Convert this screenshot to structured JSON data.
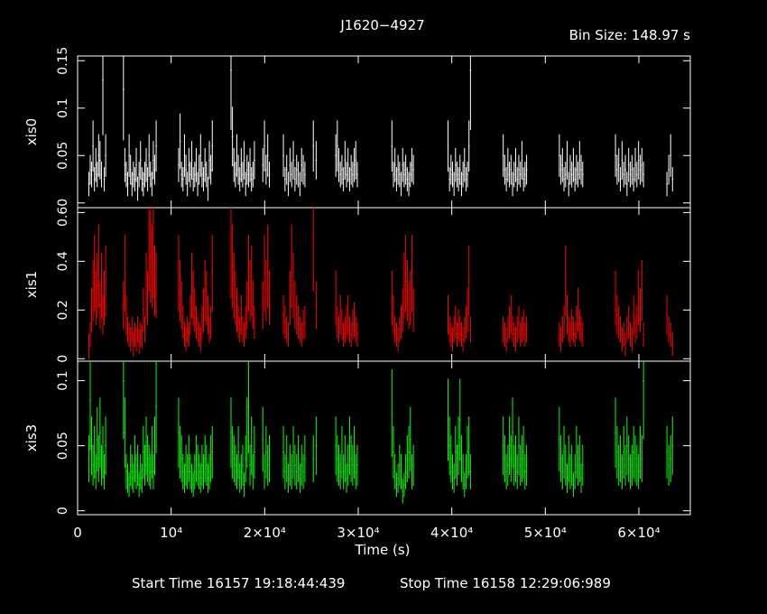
{
  "title": "J1620−4927",
  "bin_size_label": "Bin Size: 148.97 s",
  "footer": {
    "start": "Start Time 16157 19:18:44:439",
    "stop": "Stop Time 16158 12:29:06:989"
  },
  "colors": {
    "background": "#000000",
    "axes": "#ffffff",
    "xis0": "#ffffff",
    "xis1": "#ff0000",
    "xis3": "#00ff00"
  },
  "chart_data": {
    "type": "scatter",
    "title": "J1620−4927",
    "xlabel": "Time (s)",
    "xlim": [
      0,
      65500
    ],
    "x_ticks": [
      {
        "value": 0,
        "label": "0"
      },
      {
        "value": 10000,
        "label": "10⁴"
      },
      {
        "value": 20000,
        "label": "2×10⁴"
      },
      {
        "value": 30000,
        "label": "3×10⁴"
      },
      {
        "value": 40000,
        "label": "4×10⁴"
      },
      {
        "value": 50000,
        "label": "5×10⁴"
      },
      {
        "value": 60000,
        "label": "6×10⁴"
      }
    ],
    "panels": [
      {
        "name": "xis0",
        "ylabel": "xis0",
        "color": "#ffffff",
        "ylim": [
          -0.005,
          0.155
        ],
        "yticks": [
          {
            "value": 0,
            "label": ""
          },
          {
            "value": 0.05,
            "label": "0.05"
          },
          {
            "value": 0.1,
            "label": "0.1"
          },
          {
            "value": 0.15,
            "label": "0.15"
          }
        ],
        "segments": [
          {
            "t_start": 1200,
            "t_end": 3000,
            "values": [
              0.02,
              0.035,
              0.03,
              0.06,
              0.025,
              0.04,
              0.03,
              0.05,
              0.045,
              0.03,
              0.13,
              0.025,
              0.05
            ]
          },
          {
            "t_start": 4900,
            "t_end": 8400,
            "values": [
              0.12,
              0.04,
              0.03,
              0.02,
              0.05,
              0.035,
              0.02,
              0.03,
              0.025,
              0.04,
              0.015,
              0.03,
              0.045,
              0.025,
              0.02,
              0.03,
              0.04,
              0.025,
              0.05,
              0.03,
              0.02,
              0.045,
              0.035,
              0.06
            ]
          },
          {
            "t_start": 10800,
            "t_end": 14400,
            "values": [
              0.04,
              0.065,
              0.03,
              0.025,
              0.05,
              0.035,
              0.02,
              0.04,
              0.03,
              0.045,
              0.025,
              0.03,
              0.04,
              0.02,
              0.035,
              0.05,
              0.03,
              0.025,
              0.04,
              0.03,
              0.015,
              0.045,
              0.035,
              0.06
            ]
          },
          {
            "t_start": 16400,
            "t_end": 18900,
            "values": [
              0.14,
              0.07,
              0.04,
              0.03,
              0.05,
              0.035,
              0.025,
              0.04,
              0.03,
              0.045,
              0.02,
              0.035,
              0.03,
              0.04,
              0.025,
              0.03,
              0.045
            ]
          },
          {
            "t_start": 19800,
            "t_end": 20500,
            "values": [
              0.04,
              0.06,
              0.035,
              0.05,
              0.03
            ]
          },
          {
            "t_start": 22000,
            "t_end": 24300,
            "values": [
              0.05,
              0.025,
              0.035,
              0.02,
              0.04,
              0.03,
              0.045,
              0.025,
              0.035,
              0.03,
              0.02,
              0.04,
              0.035,
              0.03
            ]
          },
          {
            "t_start": 25200,
            "t_end": 25500,
            "values": [
              0.06,
              0.045
            ]
          },
          {
            "t_start": 27600,
            "t_end": 29900,
            "values": [
              0.05,
              0.06,
              0.04,
              0.03,
              0.035,
              0.025,
              0.045,
              0.03,
              0.04,
              0.025,
              0.035,
              0.03,
              0.04,
              0.045,
              0.03
            ]
          },
          {
            "t_start": 33600,
            "t_end": 35900,
            "values": [
              0.06,
              0.03,
              0.04,
              0.025,
              0.035,
              0.03,
              0.02,
              0.04,
              0.03,
              0.035,
              0.025,
              0.02,
              0.03,
              0.04,
              0.035
            ]
          },
          {
            "t_start": 39600,
            "t_end": 42000,
            "values": [
              0.06,
              0.025,
              0.035,
              0.03,
              0.02,
              0.04,
              0.03,
              0.025,
              0.035,
              0.02,
              0.03,
              0.04,
              0.025,
              0.03,
              0.06,
              0.14
            ]
          },
          {
            "t_start": 45500,
            "t_end": 48000,
            "values": [
              0.05,
              0.035,
              0.025,
              0.04,
              0.03,
              0.035,
              0.02,
              0.03,
              0.04,
              0.025,
              0.035,
              0.03,
              0.045,
              0.025,
              0.03,
              0.035
            ]
          },
          {
            "t_start": 51500,
            "t_end": 54000,
            "values": [
              0.05,
              0.035,
              0.04,
              0.025,
              0.03,
              0.045,
              0.02,
              0.035,
              0.03,
              0.04,
              0.025,
              0.035,
              0.03,
              0.045,
              0.035,
              0.03
            ]
          },
          {
            "t_start": 57500,
            "t_end": 60500,
            "values": [
              0.05,
              0.035,
              0.04,
              0.025,
              0.045,
              0.03,
              0.035,
              0.02,
              0.04,
              0.03,
              0.035,
              0.025,
              0.04,
              0.03,
              0.045,
              0.035,
              0.04,
              0.03
            ]
          },
          {
            "t_start": 63000,
            "t_end": 63600,
            "values": [
              0.02,
              0.035,
              0.05,
              0.025
            ]
          }
        ]
      },
      {
        "name": "xis1",
        "ylabel": "xis1",
        "color": "#ff0000",
        "ylim": [
          -0.01,
          0.62
        ],
        "yticks": [
          {
            "value": 0,
            "label": "0"
          },
          {
            "value": 0.2,
            "label": "0.2"
          },
          {
            "value": 0.4,
            "label": "0.4"
          },
          {
            "value": 0.6,
            "label": "0.60"
          }
        ],
        "segments": [
          {
            "t_start": 1200,
            "t_end": 3000,
            "values": [
              0.05,
              0.1,
              0.2,
              0.28,
              0.35,
              0.25,
              0.3,
              0.38,
              0.22,
              0.3,
              0.18,
              0.25,
              0.32
            ]
          },
          {
            "t_start": 4900,
            "t_end": 8400,
            "values": [
              0.22,
              0.35,
              0.18,
              0.12,
              0.1,
              0.08,
              0.12,
              0.06,
              0.1,
              0.08,
              0.12,
              0.07,
              0.1,
              0.09,
              0.2,
              0.12,
              0.3,
              0.25,
              0.5,
              0.42,
              0.38,
              0.45,
              0.32,
              0.3
            ]
          },
          {
            "t_start": 10800,
            "t_end": 14400,
            "values": [
              0.35,
              0.28,
              0.22,
              0.15,
              0.1,
              0.08,
              0.12,
              0.1,
              0.18,
              0.3,
              0.25,
              0.2,
              0.15,
              0.12,
              0.1,
              0.08,
              0.15,
              0.2,
              0.28,
              0.25,
              0.18,
              0.12,
              0.15,
              0.35
            ]
          },
          {
            "t_start": 16400,
            "t_end": 18900,
            "values": [
              0.45,
              0.38,
              0.3,
              0.25,
              0.2,
              0.15,
              0.12,
              0.18,
              0.12,
              0.1,
              0.15,
              0.22,
              0.35,
              0.28,
              0.32,
              0.22,
              0.15
            ]
          },
          {
            "t_start": 19800,
            "t_end": 20500,
            "values": [
              0.22,
              0.35,
              0.28,
              0.38,
              0.25
            ]
          },
          {
            "t_start": 22000,
            "t_end": 24300,
            "values": [
              0.18,
              0.15,
              0.12,
              0.1,
              0.25,
              0.38,
              0.3,
              0.22,
              0.18,
              0.15,
              0.12,
              0.1,
              0.14,
              0.15
            ]
          },
          {
            "t_start": 25200,
            "t_end": 25500,
            "values": [
              0.5,
              0.22
            ]
          },
          {
            "t_start": 27600,
            "t_end": 29900,
            "values": [
              0.25,
              0.15,
              0.12,
              0.18,
              0.14,
              0.1,
              0.12,
              0.15,
              0.18,
              0.12,
              0.1,
              0.14,
              0.16,
              0.12,
              0.1
            ]
          },
          {
            "t_start": 33600,
            "t_end": 35900,
            "values": [
              0.25,
              0.18,
              0.12,
              0.1,
              0.08,
              0.12,
              0.15,
              0.2,
              0.3,
              0.35,
              0.28,
              0.22,
              0.25,
              0.35,
              0.2
            ]
          },
          {
            "t_start": 39600,
            "t_end": 42000,
            "values": [
              0.18,
              0.12,
              0.1,
              0.08,
              0.12,
              0.15,
              0.1,
              0.14,
              0.12,
              0.1,
              0.08,
              0.12,
              0.15,
              0.2,
              0.32,
              0.12
            ]
          },
          {
            "t_start": 45500,
            "t_end": 48000,
            "values": [
              0.12,
              0.1,
              0.08,
              0.12,
              0.15,
              0.18,
              0.12,
              0.1,
              0.08,
              0.12,
              0.15,
              0.1,
              0.12,
              0.14,
              0.1,
              0.12
            ]
          },
          {
            "t_start": 51500,
            "t_end": 54000,
            "values": [
              0.1,
              0.08,
              0.12,
              0.15,
              0.32,
              0.18,
              0.12,
              0.1,
              0.14,
              0.12,
              0.1,
              0.15,
              0.2,
              0.14,
              0.12,
              0.1
            ]
          },
          {
            "t_start": 57500,
            "t_end": 60500,
            "values": [
              0.25,
              0.18,
              0.15,
              0.12,
              0.08,
              0.1,
              0.06,
              0.12,
              0.15,
              0.1,
              0.08,
              0.18,
              0.12,
              0.15,
              0.25,
              0.2,
              0.28,
              0.1
            ]
          },
          {
            "t_start": 63000,
            "t_end": 63600,
            "values": [
              0.18,
              0.12,
              0.1,
              0.06
            ]
          }
        ]
      },
      {
        "name": "xis3",
        "ylabel": "xis3",
        "color": "#00ff00",
        "ylim": [
          -0.003,
          0.115
        ],
        "yticks": [
          {
            "value": 0,
            "label": "0"
          },
          {
            "value": 0.05,
            "label": "0.05"
          },
          {
            "value": 0.1,
            "label": "0.1"
          }
        ],
        "segments": [
          {
            "t_start": 1200,
            "t_end": 3000,
            "values": [
              0.04,
              0.085,
              0.05,
              0.035,
              0.045,
              0.03,
              0.055,
              0.04,
              0.06,
              0.035,
              0.045,
              0.03,
              0.05
            ]
          },
          {
            "t_start": 4900,
            "t_end": 8400,
            "values": [
              0.1,
              0.06,
              0.03,
              0.025,
              0.02,
              0.035,
              0.03,
              0.025,
              0.04,
              0.03,
              0.035,
              0.02,
              0.03,
              0.025,
              0.045,
              0.035,
              0.05,
              0.04,
              0.035,
              0.03,
              0.045,
              0.03,
              0.05,
              0.08
            ]
          },
          {
            "t_start": 10800,
            "t_end": 14400,
            "values": [
              0.06,
              0.045,
              0.04,
              0.03,
              0.025,
              0.035,
              0.03,
              0.04,
              0.03,
              0.025,
              0.02,
              0.03,
              0.04,
              0.035,
              0.03,
              0.025,
              0.035,
              0.03,
              0.04,
              0.035,
              0.025,
              0.03,
              0.04,
              0.045
            ]
          },
          {
            "t_start": 16400,
            "t_end": 18900,
            "values": [
              0.06,
              0.045,
              0.04,
              0.035,
              0.03,
              0.045,
              0.025,
              0.03,
              0.035,
              0.02,
              0.04,
              0.06,
              0.08,
              0.035,
              0.05,
              0.03,
              0.045
            ]
          },
          {
            "t_start": 19800,
            "t_end": 20500,
            "values": [
              0.055,
              0.03,
              0.045,
              0.035,
              0.04
            ]
          },
          {
            "t_start": 22000,
            "t_end": 24300,
            "values": [
              0.045,
              0.03,
              0.04,
              0.025,
              0.035,
              0.03,
              0.045,
              0.035,
              0.03,
              0.04,
              0.025,
              0.035,
              0.03,
              0.04
            ]
          },
          {
            "t_start": 25200,
            "t_end": 25500,
            "values": [
              0.04,
              0.05
            ]
          },
          {
            "t_start": 27600,
            "t_end": 29900,
            "values": [
              0.05,
              0.04,
              0.035,
              0.03,
              0.045,
              0.03,
              0.04,
              0.025,
              0.035,
              0.05,
              0.04,
              0.035,
              0.045,
              0.03,
              0.035
            ]
          },
          {
            "t_start": 33600,
            "t_end": 35900,
            "values": [
              0.075,
              0.045,
              0.03,
              0.02,
              0.025,
              0.035,
              0.03,
              0.015,
              0.02,
              0.03,
              0.04,
              0.045,
              0.055,
              0.03,
              0.035
            ]
          },
          {
            "t_start": 39600,
            "t_end": 42000,
            "values": [
              0.07,
              0.05,
              0.04,
              0.03,
              0.025,
              0.045,
              0.035,
              0.05,
              0.07,
              0.04,
              0.03,
              0.02,
              0.03,
              0.045,
              0.05,
              0.03
            ]
          },
          {
            "t_start": 45500,
            "t_end": 48000,
            "values": [
              0.05,
              0.04,
              0.03,
              0.035,
              0.05,
              0.04,
              0.06,
              0.035,
              0.04,
              0.03,
              0.05,
              0.035,
              0.04,
              0.045,
              0.03,
              0.035
            ]
          },
          {
            "t_start": 51500,
            "t_end": 54000,
            "values": [
              0.055,
              0.04,
              0.03,
              0.045,
              0.035,
              0.025,
              0.04,
              0.03,
              0.035,
              0.02,
              0.03,
              0.045,
              0.035,
              0.04,
              0.025,
              0.035
            ]
          },
          {
            "t_start": 57500,
            "t_end": 60500,
            "values": [
              0.06,
              0.045,
              0.035,
              0.04,
              0.03,
              0.045,
              0.035,
              0.05,
              0.04,
              0.03,
              0.035,
              0.045,
              0.04,
              0.035,
              0.03,
              0.045,
              0.04,
              0.1
            ]
          },
          {
            "t_start": 63000,
            "t_end": 63600,
            "values": [
              0.045,
              0.035,
              0.04,
              0.05
            ]
          }
        ]
      }
    ]
  }
}
